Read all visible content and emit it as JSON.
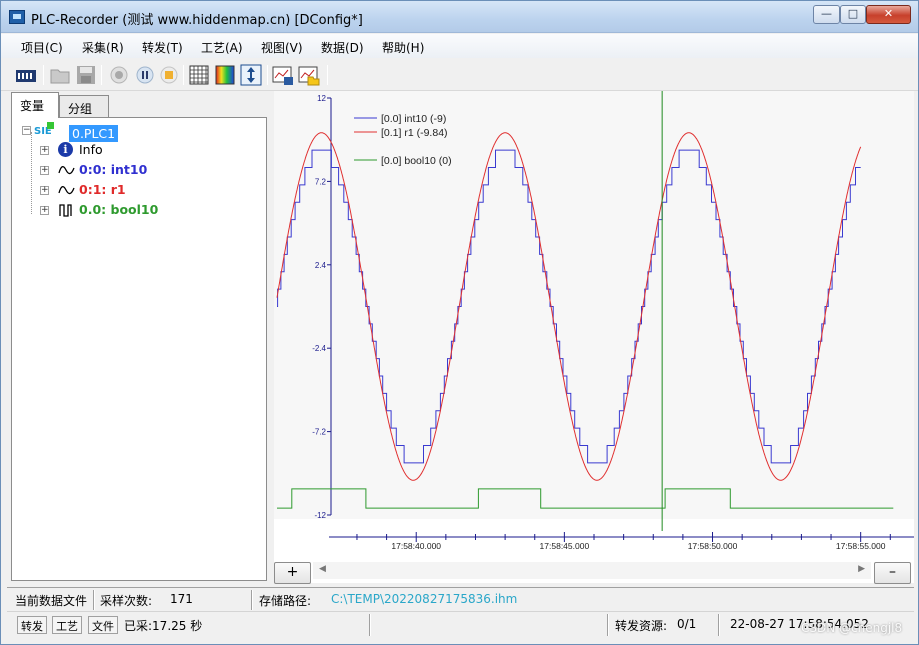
{
  "window": {
    "title": "PLC-Recorder (测试 www.hiddenmap.cn) [DConfig*]",
    "controls": {
      "minimize": "—",
      "maximize": "□",
      "close": "✕"
    }
  },
  "menu": [
    "项目(C)",
    "采集(R)",
    "转发(T)",
    "工艺(A)",
    "视图(V)",
    "数据(D)",
    "帮助(H)"
  ],
  "toolbar": [
    {
      "name": "plc-device-icon"
    },
    {
      "name": "open-folder-icon"
    },
    {
      "name": "save-disk-icon"
    },
    {
      "name": "record-icon"
    },
    {
      "name": "pause-icon"
    },
    {
      "name": "stop-icon"
    },
    {
      "name": "grid-icon"
    },
    {
      "name": "color-palette-icon"
    },
    {
      "name": "vertical-resize-icon"
    },
    {
      "name": "export-chart-icon"
    },
    {
      "name": "open-chart-icon"
    }
  ],
  "tabs": {
    "variables": "变量",
    "groups": "分组"
  },
  "tree": {
    "root_prefix": "SIE",
    "root": "0.PLC1",
    "items": [
      {
        "label": "Info",
        "icon": "info-icon",
        "color": "#000000"
      },
      {
        "label": "0:0: int10",
        "icon": "analog-wave-icon",
        "color": "#3030d0"
      },
      {
        "label": "0:1: r1",
        "icon": "analog-wave-icon",
        "color": "#e02a2a"
      },
      {
        "label": "0.0: bool10",
        "icon": "digital-pulse-icon",
        "color": "#2e9a2e"
      }
    ]
  },
  "chart_data": {
    "type": "line",
    "title": "",
    "xlabel": "",
    "ylabel": "",
    "ylim": [
      -12,
      12
    ],
    "yticks": [
      "12",
      "7.2",
      "2.4",
      "-2.4",
      "-7.2",
      "-12"
    ],
    "xticks": [
      "17:58:40.000",
      "17:58:45.000",
      "17:58:50.000",
      "17:58:55.000"
    ],
    "xrange_sec": [
      35.2,
      56.8
    ],
    "cursor_time_sec": 48.3,
    "series": [
      {
        "name": "[0.0] int10 (-9)",
        "color": "#3a3ad0",
        "kind": "int-sine",
        "amplitude": 9,
        "period_sec": 6.2,
        "phase_deg": 180,
        "center_time_sec": 36.8,
        "t_start": 35.3,
        "t_end": 55.0
      },
      {
        "name": "[0.1] r1 (-9.84)",
        "color": "#e03030",
        "kind": "sine",
        "amplitude": 10,
        "period_sec": 6.2,
        "phase_deg": 180,
        "center_time_sec": 36.8,
        "t_start": 35.3,
        "t_end": 55.0
      },
      {
        "name": "[0.0] bool10 (0)",
        "color": "#2e9a2e",
        "kind": "square",
        "high": -10.5,
        "low": -11.6,
        "high_intervals": [
          [
            35.8,
            38.3
          ],
          [
            42.1,
            44.2
          ],
          [
            48.4,
            50.6
          ]
        ],
        "t_start": 35.3,
        "t_end": 56.1
      }
    ],
    "legend_position": "top-left",
    "grid": false
  },
  "plus_button": "+",
  "minus_button": "–",
  "status": {
    "current_file_label": "当前数据文件",
    "sample_count_label": "采样次数:",
    "sample_count": "171",
    "storage_path_label": "存储路径:",
    "storage_path": "C:\\TEMP\\20220827175836.ihm",
    "btn_forward": "转发",
    "btn_process": "工艺",
    "btn_file": "文件",
    "collected": "已采:17.25 秒",
    "forward_resource_label": "转发资源:",
    "forward_resource": "0/1",
    "datetime": "22-08-27 17:58:54.052",
    "watermark": "CSDN @chengjl8"
  }
}
